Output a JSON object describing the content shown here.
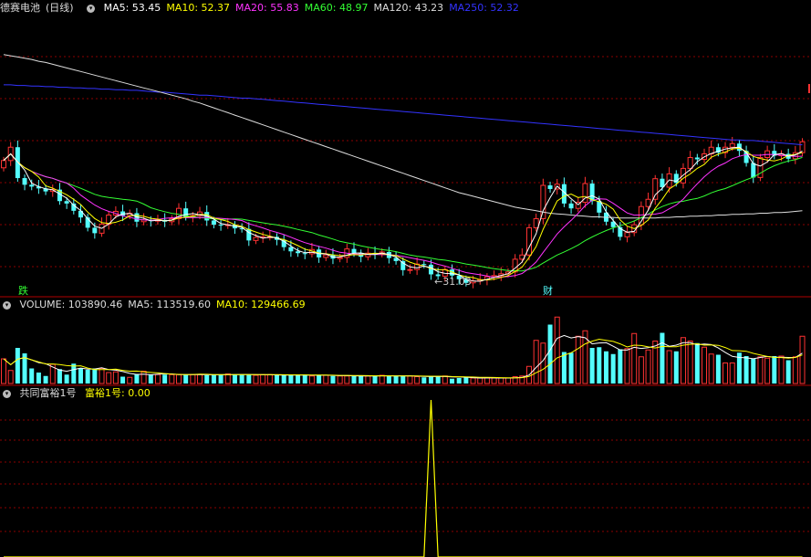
{
  "panel_main": {
    "stock_name": "德赛电池",
    "period": "(日线)",
    "ma_legend": [
      {
        "label": "MA5: 53.45",
        "color": "#ffffff"
      },
      {
        "label": "MA10: 52.37",
        "color": "#ffff00"
      },
      {
        "label": "MA20: 55.83",
        "color": "#ff33ff"
      },
      {
        "label": "MA60: 48.97",
        "color": "#33ff33"
      },
      {
        "label": "MA120: 43.23",
        "color": "#dddddd"
      },
      {
        "label": "MA250: 52.32",
        "color": "#3333ff"
      }
    ],
    "low_marker": "31.03",
    "signal_down": "跌",
    "signal_up": "财"
  },
  "panel_volume": {
    "legend": [
      {
        "label": "VOLUME: 103890.46",
        "color": "#dddddd"
      },
      {
        "label": "MA5: 113519.60",
        "color": "#dddddd"
      },
      {
        "label": "MA10: 129466.69",
        "color": "#ffff00"
      }
    ]
  },
  "panel_indicator": {
    "title": "共同富裕1号",
    "series_label": "富裕1号: 0.00"
  },
  "colors": {
    "up": "#ff3232",
    "down": "#54ffff",
    "grid": "#8b0000",
    "ma5": "#ffffff",
    "ma10": "#ffff00",
    "ma20": "#ff33ff",
    "ma60": "#33ff33",
    "ma120": "#dddddd",
    "ma250": "#3333ff",
    "indicator": "#ffff00"
  },
  "chart_data": {
    "type": "candlestick",
    "price_range": [
      29,
      75
    ],
    "closes": [
      51.5,
      53.7,
      48.6,
      47.5,
      47.2,
      46.9,
      46.4,
      46.7,
      44.8,
      44.4,
      43.2,
      42.1,
      40.4,
      39.5,
      41.0,
      42.5,
      43.1,
      42.4,
      42.8,
      41.4,
      41.7,
      41.5,
      41.7,
      41.4,
      41.9,
      43.6,
      42.2,
      42.4,
      43.0,
      41.6,
      40.9,
      40.8,
      40.9,
      40.3,
      40.2,
      38.3,
      38.8,
      38.9,
      38.9,
      38.4,
      37.2,
      36.5,
      36.2,
      36.1,
      36.8,
      35.5,
      35.9,
      35.3,
      35.5,
      36.9,
      36.2,
      35.6,
      36.2,
      36.1,
      36.4,
      35.4,
      34.9,
      33.4,
      33.5,
      34.4,
      34.3,
      32.7,
      32.4,
      33.5,
      32.5,
      31.9,
      31.3,
      31.6,
      31.8,
      32.3,
      32.5,
      32.8,
      33.1,
      35.2,
      35.9,
      40.4,
      41.9,
      47.4,
      46.8,
      47.6,
      44.4,
      43.6,
      44.6,
      47.7,
      44.8,
      42.9,
      41.4,
      40.5,
      38.9,
      39.6,
      40.9,
      43.9,
      45.1,
      48.5,
      47.1,
      49.3,
      47.8,
      50.2,
      52.0,
      51.7,
      52.6,
      53.7,
      52.8,
      53.7,
      54.3,
      53.1,
      51.1,
      48.7,
      52.0,
      53.1,
      52.3,
      52.6,
      51.8,
      52.8,
      54.6
    ],
    "volumes": [
      36000,
      19000,
      52000,
      44000,
      22000,
      16000,
      11000,
      28000,
      21000,
      13000,
      29000,
      22000,
      20000,
      22000,
      22000,
      16000,
      17000,
      10000,
      9000,
      14000,
      18000,
      13000,
      13000,
      13000,
      13000,
      13000,
      13000,
      13000,
      13000,
      12000,
      13000,
      13000,
      14000,
      13000,
      13000,
      13000,
      12000,
      13000,
      13000,
      12000,
      12000,
      12000,
      13000,
      13000,
      11000,
      12000,
      12000,
      11000,
      11000,
      11000,
      11000,
      11000,
      11000,
      11000,
      12000,
      11000,
      11000,
      11000,
      11000,
      10000,
      9000,
      10000,
      11000,
      11000,
      7000,
      8000,
      9000,
      8000,
      8000,
      8000,
      8000,
      8000,
      8000,
      10000,
      11000,
      25000,
      63000,
      59000,
      86000,
      97000,
      46000,
      45000,
      69000,
      77000,
      52000,
      53000,
      47000,
      43000,
      50000,
      51000,
      73000,
      39000,
      49000,
      62000,
      74000,
      48000,
      47000,
      67000,
      62000,
      59000,
      53000,
      43000,
      42000,
      30000,
      30000,
      45000,
      40000,
      36000,
      39000,
      37000,
      40000,
      40000,
      34000,
      39000,
      69000
    ],
    "indicator_values": [
      0,
      0,
      0,
      0,
      0,
      0,
      0,
      0,
      0,
      0,
      0,
      0,
      0,
      0,
      0,
      0,
      0,
      0,
      0,
      0,
      0,
      0,
      0,
      0,
      0,
      0,
      0,
      0,
      0,
      0,
      0,
      0,
      0,
      0,
      0,
      0,
      0,
      0,
      0,
      0,
      0,
      0,
      0,
      0,
      0,
      0,
      0,
      0,
      0,
      0,
      0,
      0,
      0,
      0,
      0,
      0,
      0,
      0,
      0,
      0,
      0,
      1,
      0,
      0,
      0,
      0,
      0,
      0,
      0,
      0,
      0,
      0,
      0,
      0,
      0,
      0,
      0,
      0,
      0,
      0,
      0,
      0,
      0,
      0,
      0,
      0,
      0,
      0,
      0,
      0,
      0,
      0,
      0,
      0,
      0,
      0,
      0,
      0,
      0,
      0,
      0,
      0,
      0,
      0,
      0,
      0,
      0,
      0,
      0,
      0,
      0,
      0,
      0,
      0,
      0
    ],
    "ma120": [
      69.0,
      68.8,
      68.6,
      68.4,
      68.2,
      67.9,
      67.7,
      67.4,
      67.1,
      66.8,
      66.5,
      66.2,
      65.9,
      65.6,
      65.3,
      65.0,
      64.7,
      64.4,
      64.1,
      63.8,
      63.5,
      63.2,
      62.9,
      62.6,
      62.3,
      62.0,
      61.7,
      61.3,
      61.0,
      60.6,
      60.2,
      59.8,
      59.4,
      59.0,
      58.6,
      58.2,
      57.8,
      57.4,
      57.0,
      56.6,
      56.2,
      55.8,
      55.4,
      55.0,
      54.6,
      54.2,
      53.8,
      53.4,
      53.0,
      52.6,
      52.2,
      51.8,
      51.4,
      51.0,
      50.6,
      50.2,
      49.8,
      49.4,
      49.0,
      48.6,
      48.2,
      47.8,
      47.4,
      47.0,
      46.6,
      46.2,
      45.9,
      45.6,
      45.3,
      45.0,
      44.7,
      44.4,
      44.1,
      43.8,
      43.6,
      43.4,
      43.2,
      43.0,
      42.8,
      42.7,
      42.6,
      42.5,
      42.4,
      42.3,
      42.2,
      42.2,
      42.1,
      42.1,
      42.0,
      42.0,
      42.0,
      42.0,
      42.0,
      42.0,
      42.1,
      42.1,
      42.2,
      42.2,
      42.3,
      42.3,
      42.4,
      42.4,
      42.5,
      42.5,
      42.6,
      42.6,
      42.7,
      42.7,
      42.8,
      42.8,
      42.9,
      42.9,
      43.0,
      43.1,
      43.2
    ],
    "ma250": [
      64.0,
      64.0,
      63.9,
      63.9,
      63.8,
      63.8,
      63.7,
      63.7,
      63.6,
      63.6,
      63.5,
      63.5,
      63.4,
      63.4,
      63.3,
      63.3,
      63.2,
      63.2,
      63.1,
      63.1,
      63.0,
      62.9,
      62.8,
      62.8,
      62.7,
      62.6,
      62.5,
      62.4,
      62.3,
      62.3,
      62.2,
      62.1,
      62.0,
      61.9,
      61.8,
      61.8,
      61.7,
      61.6,
      61.5,
      61.4,
      61.3,
      61.2,
      61.1,
      61.0,
      60.9,
      60.8,
      60.7,
      60.6,
      60.5,
      60.4,
      60.3,
      60.2,
      60.1,
      60.0,
      59.9,
      59.8,
      59.7,
      59.6,
      59.5,
      59.4,
      59.3,
      59.2,
      59.1,
      59.0,
      58.9,
      58.8,
      58.7,
      58.6,
      58.5,
      58.4,
      58.3,
      58.2,
      58.1,
      58.0,
      57.9,
      57.8,
      57.7,
      57.6,
      57.5,
      57.4,
      57.3,
      57.2,
      57.1,
      57.0,
      56.9,
      56.8,
      56.7,
      56.6,
      56.5,
      56.4,
      56.3,
      56.2,
      56.1,
      56.0,
      55.9,
      55.8,
      55.7,
      55.6,
      55.5,
      55.4,
      55.3,
      55.2,
      55.1,
      55.0,
      54.9,
      54.9,
      54.8,
      54.8,
      54.7,
      54.6,
      54.5,
      54.4,
      54.3,
      54.2,
      54.1
    ],
    "low_label_value": 31.03
  }
}
